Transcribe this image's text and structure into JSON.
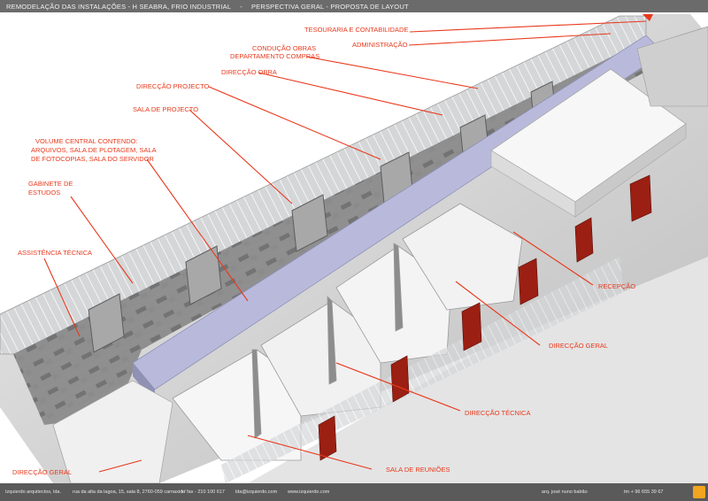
{
  "header": {
    "part1": "REMODELAÇÃO DAS INSTALAÇÕES - H SEABRA, FRIO INDUSTRIAL",
    "separator": "-",
    "part2": "PERSPECTIVA GERAL - PROPOSTA DE LAYOUT"
  },
  "labels": {
    "tesouraria": "TESOURARIA E CONTABILIDADE",
    "administracao": "ADMINISTRAÇÃO",
    "conducao_1": "CONDUÇÃO OBRAS",
    "conducao_2": "DEPARTAMENTO COMPRAS",
    "direccao_obra": "DIRECÇÃO OBRA",
    "direccao_projecto": "DIRECÇÃO PROJECTO",
    "sala_projecto": "SALA DE PROJECTO",
    "volume_1": "VOLUME CENTRAL CONTENDO:",
    "volume_2": "ARQUIVOS, SALA DE PLOTAGEM, SALA",
    "volume_3": "DE FOTOCOPIAS, SALA DO SERVIDOR",
    "gabinete_1": "GABINETE DE",
    "gabinete_2": "ESTUDOS",
    "assistencia": "ASSISTÊNCIA TÉCNICA",
    "recepcao": "RECEPÇÃO",
    "direccao_geral_right": "DIRECÇÃO GERAL",
    "direccao_tecnica": "DIRECÇÃO TÉCNICA",
    "sala_reunioes": "SALA DE REUNIÕES",
    "direccao_geral_left": "DIRECÇÃO GERAL"
  },
  "footer": {
    "company": "Izquierdo arquitectos, lda.",
    "address": "rua da alta da lagoa, 15, sala 8, 2760-059 carnaxide",
    "phone": "t / fax - 210 100 617",
    "email": "lda@izquierdo.com",
    "web": "www.izquierdo.com",
    "architect": "arq. josé nuno balrão",
    "mobile": "tm + 96 655 39 67"
  },
  "colors": {
    "accent": "#e8391d",
    "header_bg": "#6b6b6b",
    "corridor": "#b9badb",
    "logo": "#f3a520"
  }
}
